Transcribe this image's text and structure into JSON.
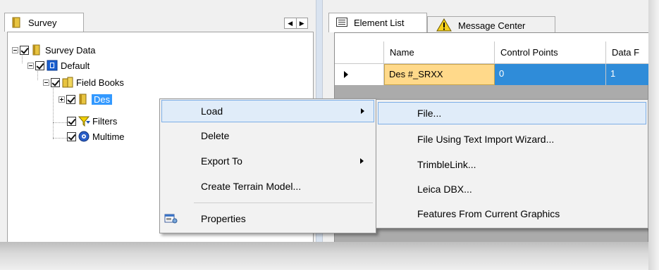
{
  "left_tab": {
    "label": "Survey"
  },
  "tree": {
    "survey_data": "Survey Data",
    "default": "Default",
    "field_books": "Field Books",
    "des_item": "Des",
    "filters": "Filters",
    "multimedia": "Multime"
  },
  "right_tabs": {
    "element_list": "Element List",
    "message_center": "Message Center"
  },
  "grid": {
    "columns": [
      "Name",
      "Control Points",
      "Data F"
    ],
    "row": {
      "name": "Des #_SRXX",
      "control_points": "0",
      "data": "1"
    }
  },
  "context_menu": {
    "items": [
      "Load",
      "Delete",
      "Export To",
      "Create Terrain Model...",
      "Properties"
    ]
  },
  "submenu": {
    "items": [
      "File...",
      "File Using Text Import Wizard...",
      "TrimbleLink...",
      "Leica DBX...",
      "Features From Current Graphics"
    ]
  },
  "colors": {
    "selection": "#3399ff",
    "row_highlight_name": "#ffd98a",
    "row_highlight_values": "#2f8cd9",
    "menu_hover": "#e0ecf9"
  }
}
